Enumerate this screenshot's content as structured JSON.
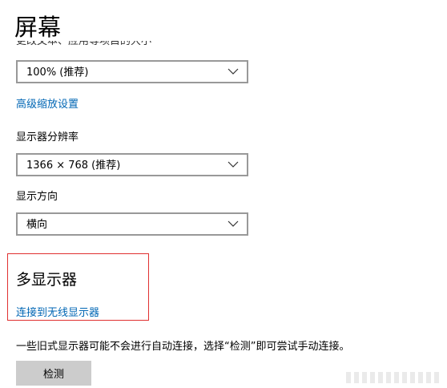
{
  "header": {
    "title": "屏幕"
  },
  "scale": {
    "clipped_label": "更改文本、应用等项目的大小",
    "selected": "100% (推荐)",
    "advanced_link": "高级缩放设置"
  },
  "resolution": {
    "label": "显示器分辨率",
    "selected": "1366 × 768 (推荐)"
  },
  "orientation": {
    "label": "显示方向",
    "selected": "横向"
  },
  "multi_display": {
    "title": "多显示器",
    "wireless_link": "连接到无线显示器",
    "note": "一些旧式显示器可能不会进行自动连接，选择“检测”即可尝试手动连接。",
    "detect_button": "检测"
  },
  "colors": {
    "link": "#0066b4",
    "highlight_border": "#e03030",
    "button_bg": "#cccccc",
    "dropdown_border": "#999999"
  },
  "icons": {
    "dropdown": "chevron-down-icon"
  }
}
